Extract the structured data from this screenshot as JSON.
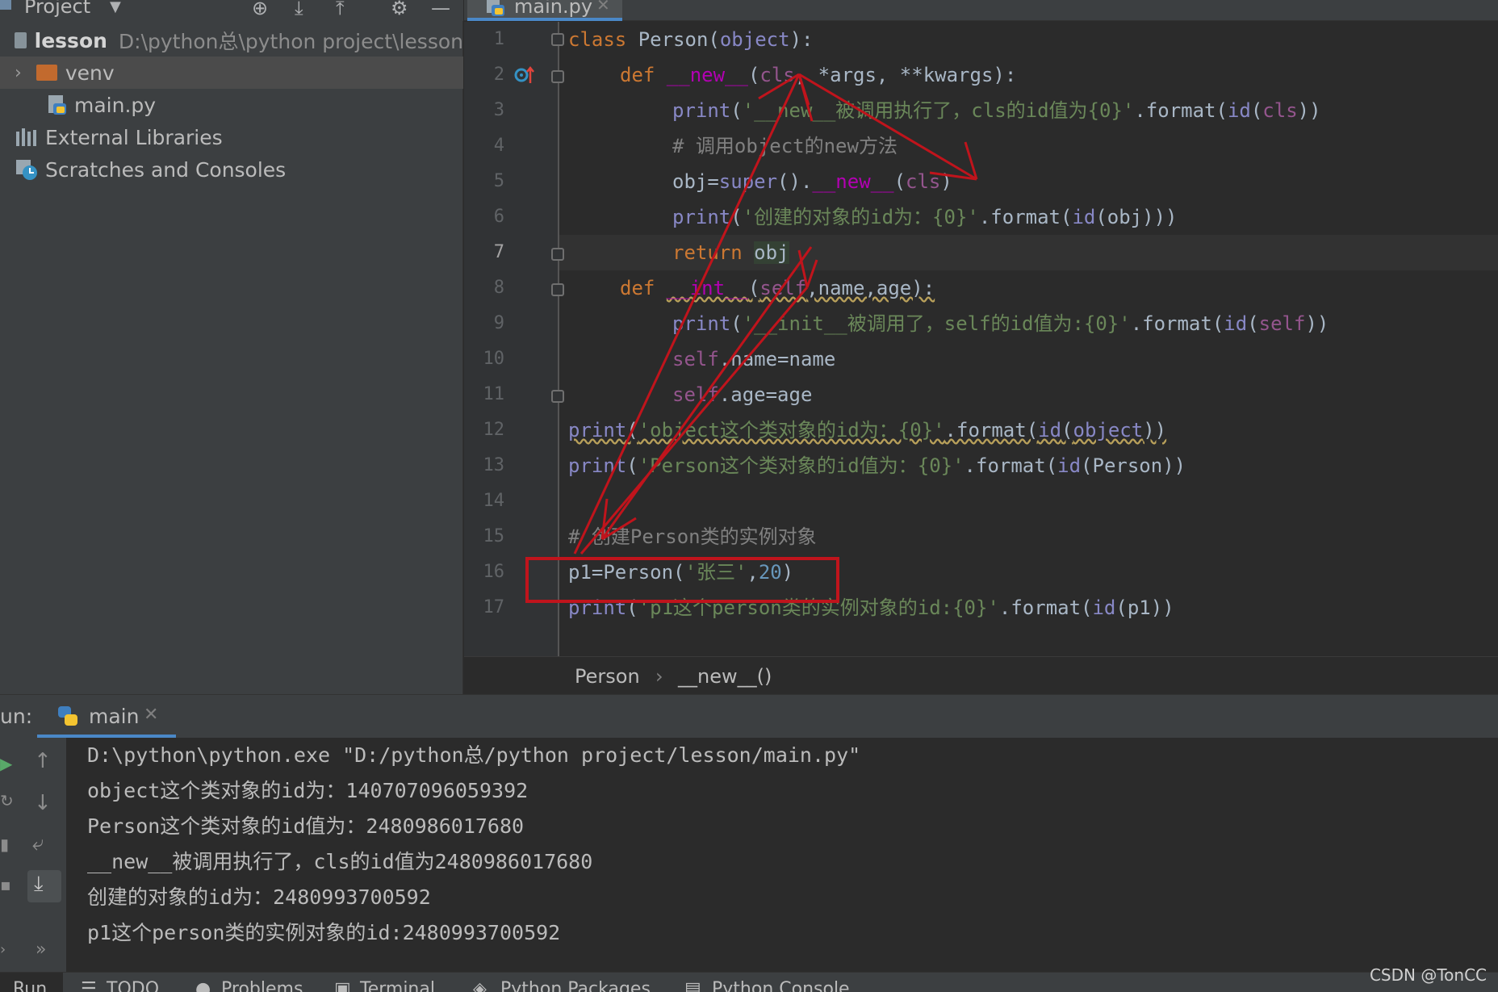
{
  "toolbar": {
    "project_label": "Project"
  },
  "tree": [
    {
      "name": "lesson",
      "path": "D:\\python总\\python project\\lesson"
    },
    {
      "name": "venv"
    },
    {
      "name": "main.py"
    },
    {
      "name": "External Libraries"
    },
    {
      "name": "Scratches and Consoles"
    }
  ],
  "editor_tab": {
    "label": "main.py"
  },
  "line_numbers": [
    "1",
    "2",
    "3",
    "4",
    "5",
    "6",
    "7",
    "8",
    "9",
    "10",
    "11",
    "12",
    "13",
    "14",
    "15",
    "16",
    "17"
  ],
  "code": {
    "l1_kw": "class ",
    "l1_rest": "Person(",
    "l1_obj": "object",
    "l1_end": "):",
    "l2_kw": "def ",
    "l2_fn": "__new__",
    "l2_p": "(",
    "l2_cls": "cls",
    "l2_rest": ", *args, **kwargs):",
    "l3_fn": "print",
    "l3_p": "(",
    "l3_str": "'__new__被调用执行了，cls的id值为{0}'",
    "l3_fmt": ".format(",
    "l3_id": "id",
    "l3_p2": "(",
    "l3_cls": "cls",
    "l3_end": "))",
    "l4_cm": "# 调用object的new方法",
    "l5_a": "obj=",
    "l5_fn": "super",
    "l5_b": "().",
    "l5_dm": "__new__",
    "l5_p": "(",
    "l5_cls": "cls",
    "l5_end": ")",
    "l6_fn": "print",
    "l6_p": "(",
    "l6_str": "'创建的对象的id为：{0}'",
    "l6_fmt": ".format(",
    "l6_id": "id",
    "l6_rest": "(obj)))",
    "l7_kw": "return ",
    "l7_rest": "obj",
    "l8_kw": "def ",
    "l8_fn": "__int__",
    "l8_p": "(",
    "l8_self": "self",
    "l8_rest": ",name,age):",
    "l9_fn": "print",
    "l9_p": "(",
    "l9_str": "'__init__被调用了，self的id值为:{0}'",
    "l9_fmt": ".format(",
    "l9_id": "id",
    "l9_p2": "(",
    "l9_self": "self",
    "l9_end": "))",
    "l10_self": "self",
    "l10_rest": ".name=name",
    "l11_self": "self",
    "l11_rest": ".age=age",
    "l12_fn": "print",
    "l12_p": "(",
    "l12_str": "'object这个类对象的id为：{0}'",
    "l12_fmt": ".format(",
    "l12_id": "id",
    "l12_p2": "(",
    "l12_obj": "object",
    "l12_end": "))",
    "l13_fn": "print",
    "l13_p": "(",
    "l13_str": "'Person这个类对象的id值为：{0}'",
    "l13_fmt": ".format(",
    "l13_id": "id",
    "l13_rest": "(Person))",
    "l15_cm": "# 创建Person类的实例对象",
    "l16_a": "p1=Person(",
    "l16_str": "'张三'",
    "l16_b": ",",
    "l16_num": "20",
    "l16_end": ")",
    "l17_fn": "print",
    "l17_p": "(",
    "l17_str": "'p1这个person类的实例对象的id:{0}'",
    "l17_fmt": ".format(",
    "l17_id": "id",
    "l17_rest": "(p1))"
  },
  "breadcrumb": {
    "class": "Person",
    "sep": "›",
    "method": "__new__()"
  },
  "run": {
    "label": "un:",
    "tab": "main"
  },
  "console_lines": [
    "D:\\python\\python.exe \"D:/python总/python project/lesson/main.py\"",
    "object这个类对象的id为：140707096059392",
    "Person这个类对象的id值为：2480986017680",
    "__new__被调用执行了，cls的id值为2480986017680",
    "创建的对象的id为：2480993700592",
    "p1这个person类的实例对象的id:2480993700592"
  ],
  "bottom_tabs": [
    "Run",
    "TODO",
    "Problems",
    "Terminal",
    "Python Packages",
    "Python Console"
  ],
  "watermark": "CSDN @TonCC",
  "colors": {
    "annotation": "#c0141c",
    "accent": "#4a88c7"
  }
}
